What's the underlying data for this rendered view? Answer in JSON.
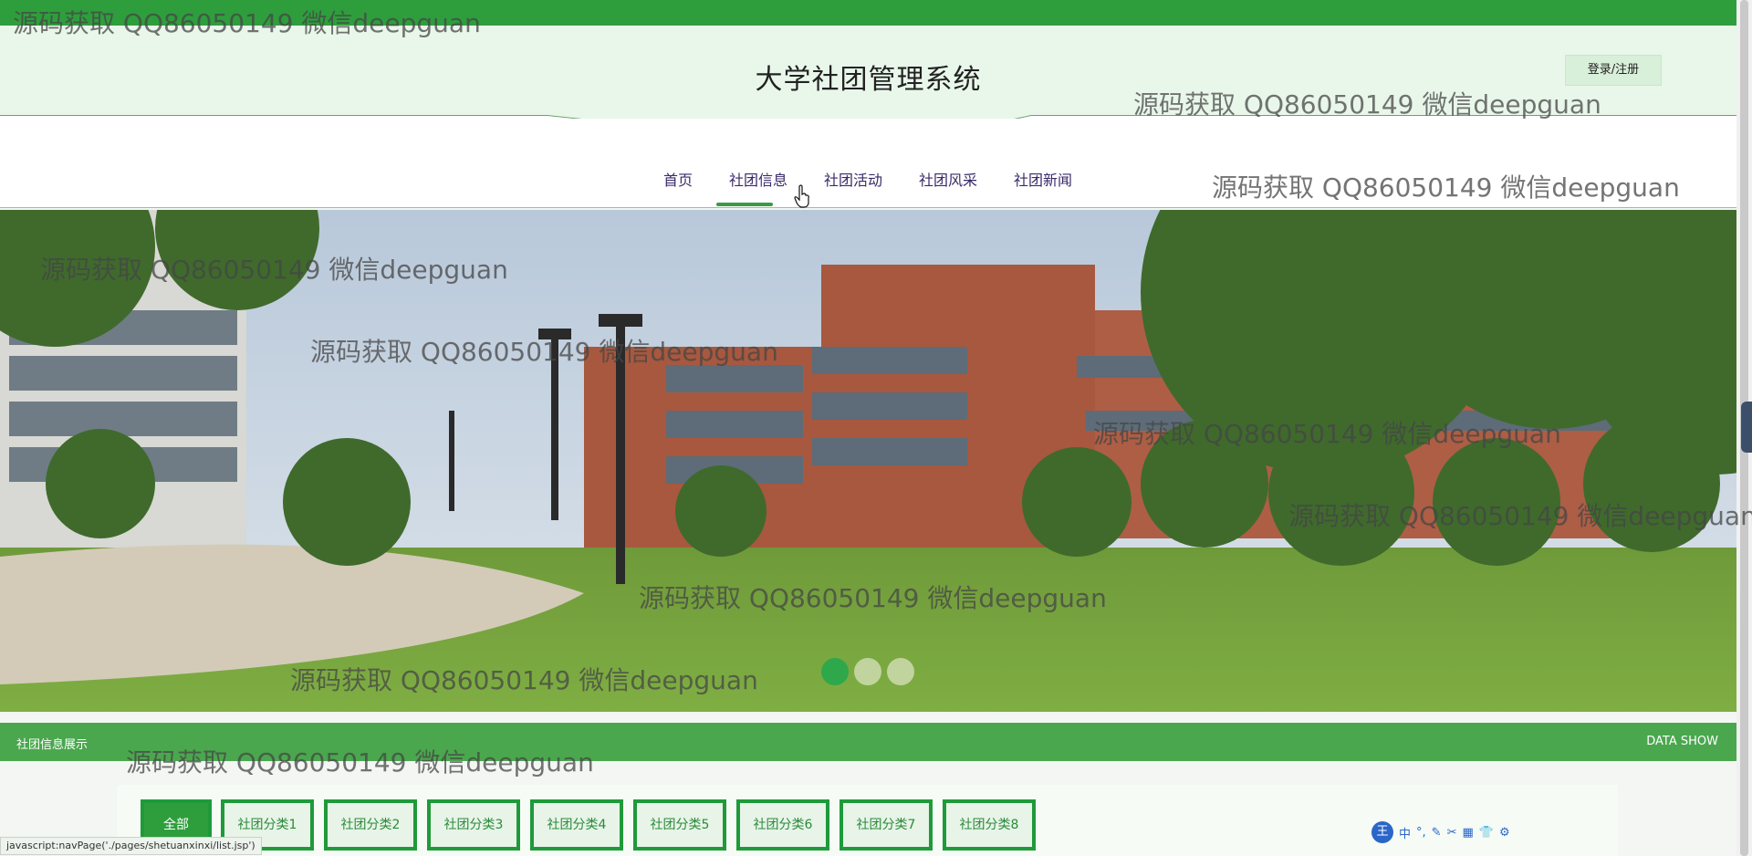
{
  "site": {
    "title": "大学社团管理系统",
    "login_label": "登录/注册"
  },
  "nav": {
    "items": [
      {
        "label": "首页"
      },
      {
        "label": "社团信息"
      },
      {
        "label": "社团活动"
      },
      {
        "label": "社团风采"
      },
      {
        "label": "社团新闻"
      }
    ],
    "active_index": 1
  },
  "banner": {
    "slides": 3,
    "active_slide": 0
  },
  "section": {
    "title": "社团信息展示",
    "right_label": "DATA SHOW"
  },
  "categories": [
    "全部",
    "社团分类1",
    "社团分类2",
    "社团分类3",
    "社团分类4",
    "社团分类5",
    "社团分类6",
    "社团分类7",
    "社团分类8"
  ],
  "status_bar": "javascript:navPage('./pages/shetuanxinxi/list.jsp')",
  "ime": {
    "logo": "王",
    "chars": [
      "中",
      "°,",
      "✎",
      "✂",
      "▦",
      "👕",
      "⚙"
    ]
  },
  "watermark": "源码获取 QQ86050149 微信deepguan",
  "colors": {
    "brand_green": "#2e9e3d",
    "section_green": "#4aa74e",
    "nav_text": "#3a2a6a",
    "header_bg": "#e9f7ea"
  },
  "icons": {
    "cursor": "hand-pointer-icon",
    "ime": "sogou-ime-icon"
  }
}
